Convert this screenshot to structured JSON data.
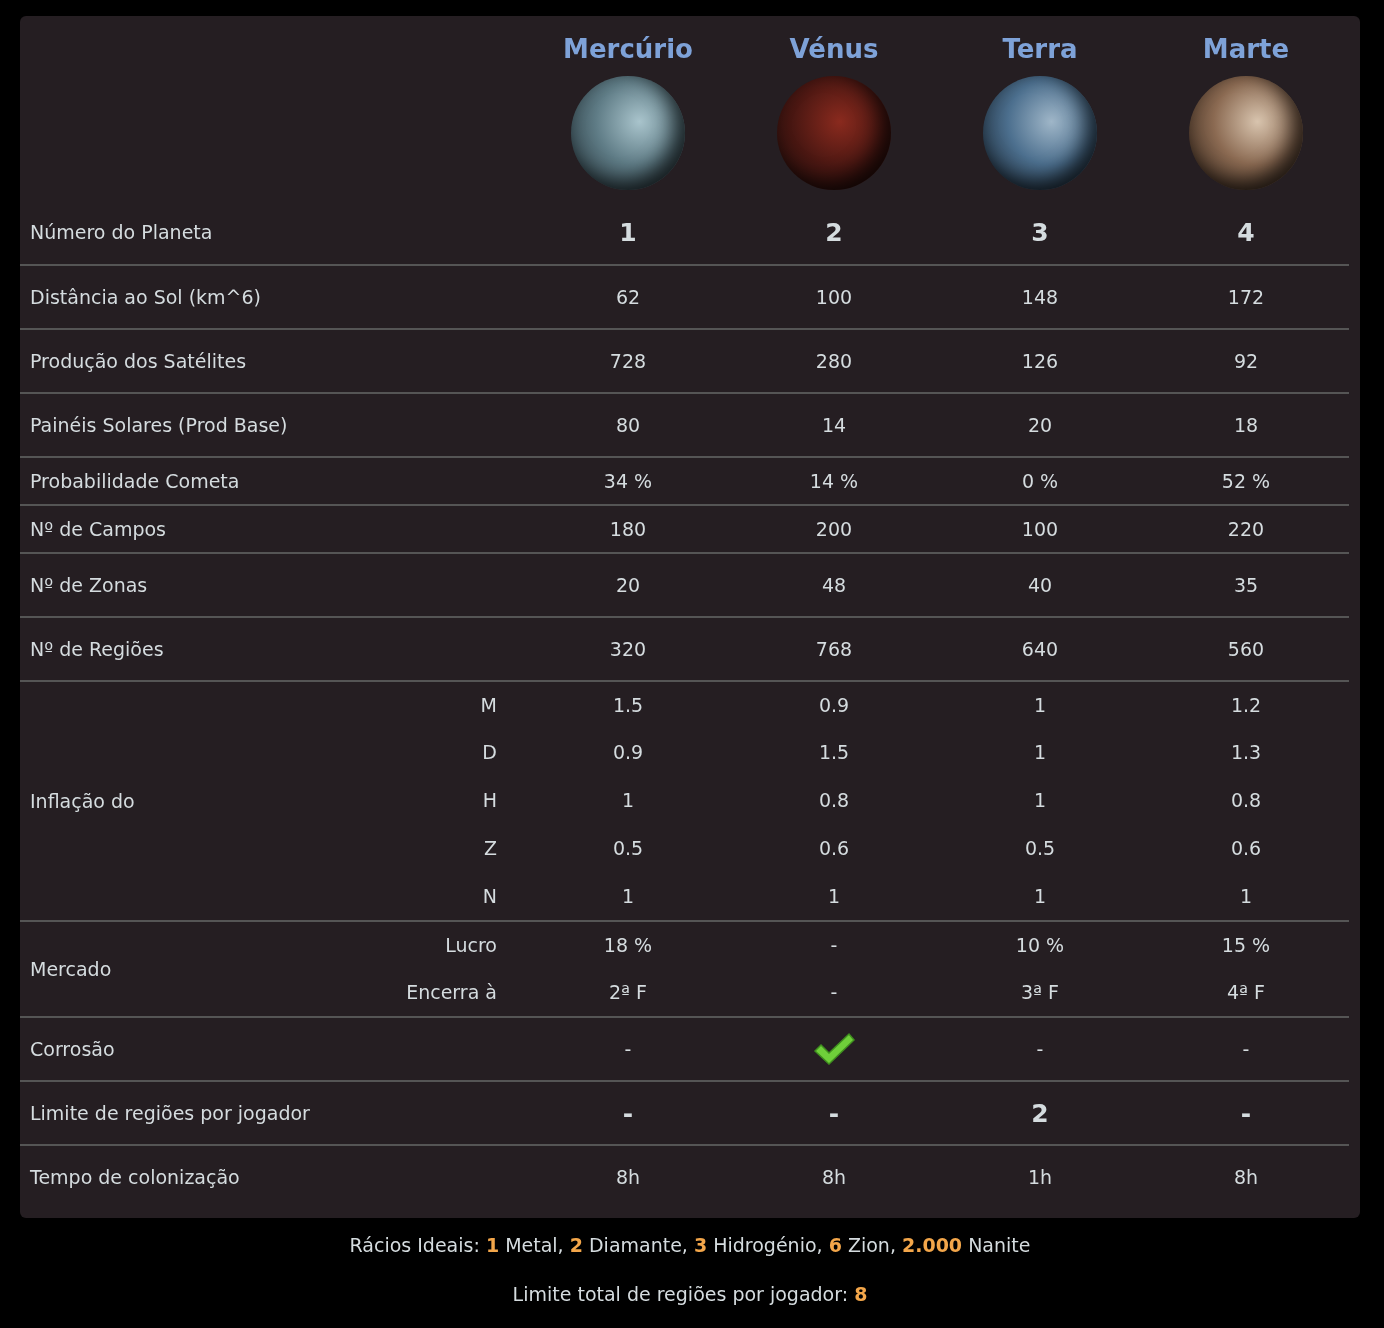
{
  "planets": [
    {
      "name": "Mercúrio"
    },
    {
      "name": "Vénus"
    },
    {
      "name": "Terra"
    },
    {
      "name": "Marte"
    }
  ],
  "rows": [
    {
      "kind": "number",
      "label": "Número do Planeta",
      "values": [
        "1",
        "2",
        "3",
        "4"
      ]
    },
    {
      "kind": "plain",
      "label": "Distância ao Sol (km^6)",
      "values": [
        "62",
        "100",
        "148",
        "172"
      ]
    },
    {
      "kind": "plain",
      "label": "Produção dos Satélites",
      "values": [
        "728",
        "280",
        "126",
        "92"
      ]
    },
    {
      "kind": "plain",
      "label": "Painéis Solares (Prod Base)",
      "values": [
        "80",
        "14",
        "20",
        "18"
      ]
    },
    {
      "kind": "plain",
      "label": "Probabilidade Cometa",
      "values": [
        "34 %",
        "14 %",
        "0 %",
        "52 %"
      ]
    },
    {
      "kind": "plain",
      "label": "Nº de Campos",
      "values": [
        "180",
        "200",
        "100",
        "220"
      ]
    },
    {
      "kind": "plain",
      "label": "Nº de Zonas",
      "values": [
        "20",
        "48",
        "40",
        "35"
      ]
    },
    {
      "kind": "plain",
      "label": "Nº de Regiões",
      "values": [
        "320",
        "768",
        "640",
        "560"
      ]
    },
    {
      "kind": "group",
      "label": "Inflação do",
      "subrows": [
        {
          "label": "M",
          "values": [
            "1.5",
            "0.9",
            "1",
            "1.2"
          ]
        },
        {
          "label": "D",
          "values": [
            "0.9",
            "1.5",
            "1",
            "1.3"
          ]
        },
        {
          "label": "H",
          "values": [
            "1",
            "0.8",
            "1",
            "0.8"
          ]
        },
        {
          "label": "Z",
          "values": [
            "0.5",
            "0.6",
            "0.5",
            "0.6"
          ]
        },
        {
          "label": "N",
          "values": [
            "1",
            "1",
            "1",
            "1"
          ]
        }
      ]
    },
    {
      "kind": "group",
      "label": "Mercado",
      "subrows": [
        {
          "label": "Lucro",
          "values": [
            "18 %",
            "-",
            "10 %",
            "15 %"
          ]
        },
        {
          "label": "Encerra à",
          "values": [
            "2ª F",
            "-",
            "3ª F",
            "4ª F"
          ]
        }
      ]
    },
    {
      "kind": "flag",
      "label": "Corrosão",
      "values": [
        {
          "checked": false,
          "text": "-"
        },
        {
          "checked": true
        },
        {
          "checked": false,
          "text": "-"
        },
        {
          "checked": false,
          "text": "-"
        }
      ]
    },
    {
      "kind": "number",
      "label": "Limite de regiões por jogador",
      "values": [
        "-",
        "-",
        "2",
        "-"
      ]
    },
    {
      "kind": "plain",
      "label": "Tempo de colonização",
      "values": [
        "8h",
        "8h",
        "1h",
        "8h"
      ]
    }
  ],
  "footer": [
    "Rácios Ideais: **1** Metal, **2** Diamante, **3** Hidrogénio, **6** Zion, **2.000** Nanite",
    "Limite total de regiões por jogador: **8**"
  ]
}
